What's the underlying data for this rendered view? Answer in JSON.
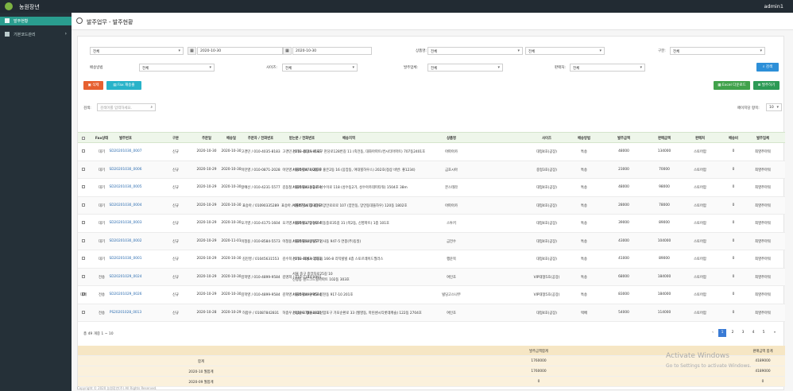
{
  "app": {
    "title": "농원장년",
    "user": "admin1"
  },
  "sidebar": {
    "items": [
      {
        "label": "발주현황"
      },
      {
        "label": "기본코드관리"
      }
    ]
  },
  "page": {
    "title": "발주업무 - 발주현황"
  },
  "filters": {
    "f1": "전체",
    "date_from": "2020-10-30",
    "date_to": "2020-10-30",
    "prod_label": "상품명:",
    "prod_v1": "전체",
    "prod_v2": "전체",
    "cat_label": "구분:",
    "cat": "전체",
    "delivery_label": "배송방법",
    "delivery": "전체",
    "size_label": "사이즈:",
    "size": "전체",
    "org_label": "발주업체:",
    "org": "전체",
    "pay_label": "판매처:",
    "pay": "전체",
    "search": "검색"
  },
  "buttons": {
    "delete": "삭제",
    "fax": "Fax 재송출",
    "excel": "Excel 다운로드",
    "order": "발주하기"
  },
  "search": {
    "label": "검색:",
    "placeholder": "검색어를 입력하세요.",
    "page_size_label": "페이지당 항목:",
    "page_size": "10"
  },
  "table": {
    "headers": [
      "Fax상태",
      "발주번호",
      "구분",
      "주문일",
      "배송일",
      "주문자 / 전화번호",
      "받는분 / 전화번호",
      "배송지역",
      "상품명",
      "사이즈",
      "배송방법",
      "발주금액",
      "판매금액",
      "판매처",
      "배송비",
      "발주업체"
    ],
    "rows": [
      {
        "mark": "",
        "fax": "대기",
        "no": "SD20201030_0007",
        "type": "신규",
        "od": "2020-10-30",
        "dd": "2020-10-30",
        "orderer": "고경민 / 010-4035-8183",
        "recv": "고경민 / 010-4035-8183",
        "addr": "경기도 용인시 수지구 천당로128번길 11 (죽전동, 대화아파트/컨시티아파트) 707동2401호",
        "addr2": "",
        "prod": "아파아카",
        "size": "대형4호(공장)",
        "ship": "특송",
        "amt": "48000",
        "sale": "134000",
        "shop": "스토어팜",
        "fee": "0",
        "vendor": "최영주마워"
      },
      {
        "mark": "",
        "fax": "대기",
        "no": "SD20201030_0006",
        "type": "신규",
        "od": "2020-10-29",
        "dd": "2020-10-30",
        "orderer": "이민영 / 010-0871-2028",
        "recv": "이민영 / 010-0871-2028",
        "addr": "서울특별시 서대문구 홍은2동 16 (응앙동, 여대힐하우스) 202호(정상 비번: 좋1234)",
        "addr2": "",
        "prod": "금호시아",
        "size": "중형3호(공장)",
        "ship": "특송",
        "amt": "23000",
        "sale": "70000",
        "shop": "스토어팜",
        "fee": "0",
        "vendor": "최영주마워"
      },
      {
        "mark": "",
        "fax": "대기",
        "no": "SD20201030_0005",
        "type": "신규",
        "od": "2020-10-29",
        "dd": "2020-10-30",
        "orderer": "왕예선 / 010-4231-5577",
        "recv": "김동철 / 010-8833-2459",
        "addr": "서울특별시 성동구 성수이로 118 (성수동2가, 성수아카데미타워) 1504호 38m",
        "addr2": "",
        "prod": "몬스테라",
        "size": "대형4호(공장)",
        "ship": "특송",
        "amt": "48000",
        "sale": "98000",
        "shop": "스토어팜",
        "fee": "0",
        "vendor": "최영주마워"
      },
      {
        "mark": "",
        "fax": "대기",
        "no": "SD20201030_0004",
        "type": "신규",
        "od": "2020-10-29",
        "dd": "2020-10-30",
        "orderer": "표승아 / 01090335289",
        "recv": "표승아 / 0507-1872-4164",
        "addr": "서울특별시 동대문구 망안로로로 107 (양안동, 망안동대뜰하우) 120동 1802호",
        "addr2": "",
        "prod": "아파아카",
        "size": "대형4호(공장)",
        "ship": "특송",
        "amt": "28000",
        "sale": "78000",
        "shop": "스토어팜",
        "fee": "0",
        "vendor": "최영주마워"
      },
      {
        "mark": "",
        "fax": "대기",
        "no": "SD20201030_0003",
        "type": "신규",
        "od": "2020-10-29",
        "dd": "2020-10-30",
        "orderer": "오기영 / 010-4175-1604",
        "recv": "오기영 / 010-4175-1604",
        "addr": "서울특별시 양천구 목동중로35길 31 (목2동, 신영파트) 1층 101호",
        "addr2": "",
        "prod": "스투키",
        "size": "대형4호(공장)",
        "ship": "특송",
        "amt": "39000",
        "sale": "89000",
        "shop": "스토어팜",
        "fee": "0",
        "vendor": "최영주마워"
      },
      {
        "mark": "",
        "fax": "대기",
        "no": "SD20201030_0002",
        "type": "신규",
        "od": "2020-10-29",
        "dd": "2020-11-01",
        "orderer": "이청용 / 010-8584-5573",
        "recv": "이청용 / 010-8584-5573",
        "addr": "서울특별시 양남구 인사동 947-5 연봉(주)동일)",
        "addr2": "",
        "prod": "금전수",
        "size": "대형4호(공장)",
        "ship": "특송",
        "amt": "43000",
        "sale": "104000",
        "shop": "스토어팜",
        "fee": "0",
        "vendor": "최영주마워"
      },
      {
        "mark": "",
        "fax": "대기",
        "no": "SD20201030_0001",
        "type": "신규",
        "od": "2020-10-29",
        "dd": "2020-10-30",
        "orderer": "김진영 / 01045631553",
        "recv": "김수희 / 010-4063-1553",
        "addr": "경기도 화성시 봉담읍 166-8 리틱빌빌 4층 스토르레이드필러스",
        "addr2": "",
        "prod": "행운목",
        "size": "대형4호(공장)",
        "ship": "특송",
        "amt": "41000",
        "sale": "89000",
        "shop": "스토어팜",
        "fee": "0",
        "vendor": "최영주마워"
      },
      {
        "mark": "",
        "fax": "전송",
        "no": "SD20201029_0024",
        "type": "신규",
        "od": "2020-10-29",
        "dd": "2020-10-30",
        "orderer": "김학영 / 010-4899-9584",
        "recv": "김명희 / 010-7184-0991",
        "addr": "서울 중구 중앙차로25길 10",
        "addr2": "신항동 랜드크드힐아파트 102동 303호",
        "prod": "여인초",
        "size": "VIP대형5호(공장)",
        "ship": "특송",
        "amt": "68000",
        "sale": "184000",
        "shop": "스토어팜",
        "fee": "0",
        "vendor": "최영주마워"
      },
      {
        "mark": "대체",
        "fax": "전송",
        "no": "SD20201029_0026",
        "type": "신규",
        "od": "2020-10-29",
        "dd": "2020-10-30",
        "orderer": "김학영 / 010-4899-9584",
        "recv": "김학영 / 010-4899-9584",
        "addr": "서울특별시 관악구 봉천동 917-10 201호",
        "addr2": "",
        "prod": "빌딩고스나무",
        "size": "VIP대형5호(공장)",
        "ship": "특송",
        "amt": "83000",
        "sale": "184000",
        "shop": "스토어팜",
        "fee": "0",
        "vendor": "최영주마워"
      },
      {
        "mark": "",
        "fax": "전송",
        "no": "PS20201028_0013",
        "type": "신규",
        "od": "2020-10-28",
        "dd": "2020-10-29",
        "orderer": "허종우 / 01087842831",
        "recv": "허종우 / 010-8784-2831",
        "addr": "경상남도 창원시 의산합포구 가포순환로 33 (월영동, 마린센시티롯데캐슬) 122동 2704호",
        "addr2": "",
        "prod": "여인초",
        "size": "대형4호(공장)",
        "ship": "택배",
        "amt": "54000",
        "sale": "114000",
        "shop": "스토어팜",
        "fee": "0",
        "vendor": "최영주마워"
      }
    ]
  },
  "paging": {
    "info": "총 49 개중 1 ~ 10",
    "prev": "‹",
    "pages": [
      "1",
      "2",
      "3",
      "4",
      "5"
    ],
    "next": "›",
    "last": "»"
  },
  "summary": {
    "col1": "발주금액합계",
    "col2": "판매금액 합계",
    "rows": [
      {
        "label": "합계",
        "a": "1760000",
        "b": "4189000"
      },
      {
        "label": "2020-10 월합계",
        "a": "1760000",
        "b": "4189000"
      },
      {
        "label": "2020-09 월합계",
        "a": "0",
        "b": "0"
      }
    ]
  },
  "footer": "Copyright © 2020 농원장년(주) All Rights Reserved.",
  "watermark": {
    "t1": "Activate Windows",
    "t2": "Go to Settings to activate Windows."
  }
}
